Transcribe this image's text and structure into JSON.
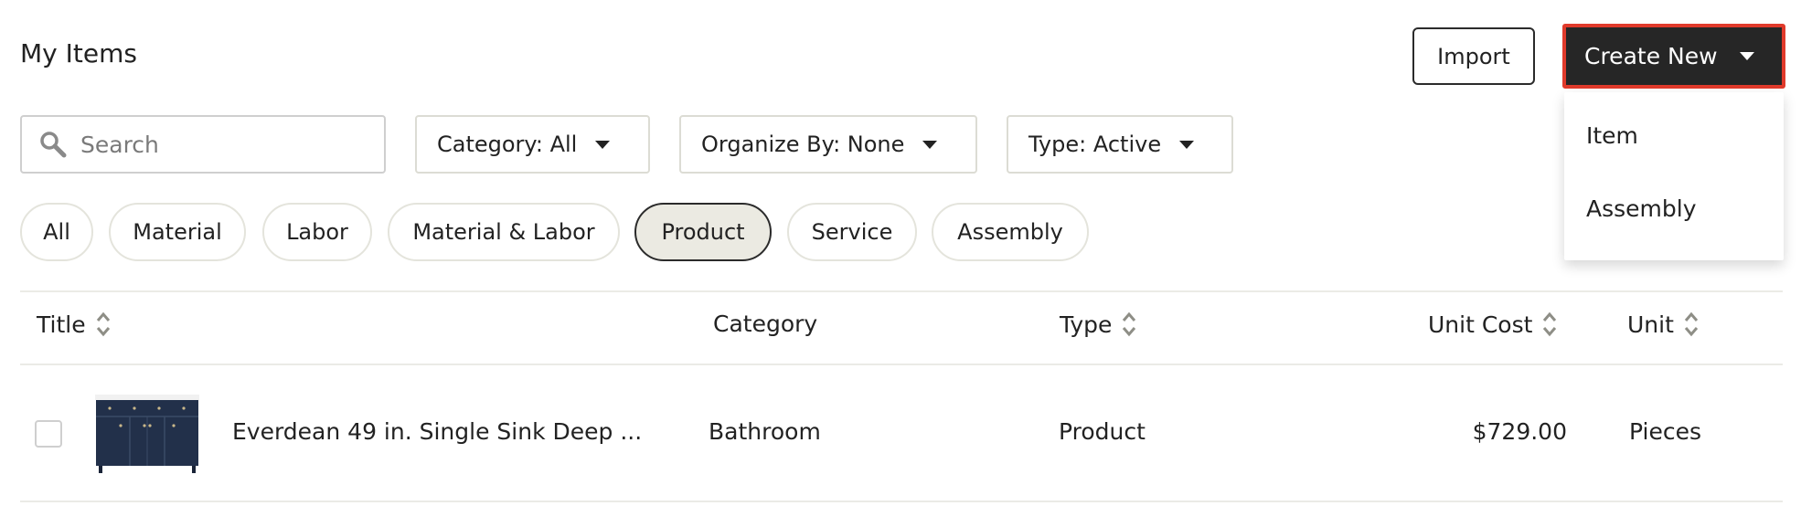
{
  "header": {
    "title": "My Items",
    "import_label": "Import",
    "create_label": "Create New"
  },
  "create_menu": {
    "items": [
      "Item",
      "Assembly"
    ]
  },
  "search": {
    "placeholder": "Search"
  },
  "filters": {
    "category": "Category: All",
    "organize": "Organize By: None",
    "type": "Type: Active"
  },
  "chips": [
    "All",
    "Material",
    "Labor",
    "Material & Labor",
    "Product",
    "Service",
    "Assembly"
  ],
  "active_chip": "Product",
  "table": {
    "columns": [
      "Title",
      "Category",
      "Type",
      "Unit Cost",
      "Unit"
    ],
    "rows": [
      {
        "title": "Everdean 49 in. Single Sink Deep ...",
        "category": "Bathroom",
        "type": "Product",
        "unit_cost": "$729.00",
        "unit": "Pieces"
      }
    ]
  },
  "colors": {
    "accent_highlight": "#e03a2b",
    "primary_button": "#262626",
    "active_chip_bg": "#ebeae2"
  },
  "icons": {
    "search": "search-icon",
    "sort": "sort-icon",
    "caret": "chevron-down-icon"
  }
}
